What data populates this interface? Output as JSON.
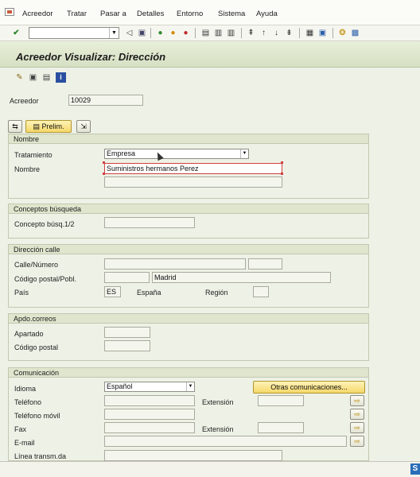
{
  "menu": [
    "Acreedor",
    "Tratar",
    "Pasar a",
    "Detalles",
    "Entorno",
    "Sistema",
    "Ayuda"
  ],
  "title": "Acreedor Visualizar: Dirección",
  "acreedor": {
    "label": "Acreedor",
    "value": "10029"
  },
  "prelim_label": "Prelim.",
  "nombre": {
    "header": "Nombre",
    "tratamiento_label": "Tratamiento",
    "tratamiento_value": "Empresa",
    "nombre_label": "Nombre",
    "nombre_value": "Suministros hermanos Perez"
  },
  "conceptos": {
    "header": "Conceptos búsqueda",
    "label": "Concepto búsq.1/2"
  },
  "direccion": {
    "header": "Dirección calle",
    "calle_label": "Calle/Número",
    "cp_label": "Código postal/Pobl.",
    "poblacion": "Madrid",
    "pais_label": "País",
    "pais_code": "ES",
    "pais_name": "España",
    "region_label": "Región"
  },
  "apdo": {
    "header": "Apdo.correos",
    "apartado_label": "Apartado",
    "cp_label": "Código postal"
  },
  "comunicacion": {
    "header": "Comunicación",
    "idioma_label": "Idioma",
    "idioma_value": "Español",
    "otras_button": "Otras comunicaciones...",
    "telefono_label": "Teléfono",
    "extension_label": "Extensión",
    "movil_label": "Teléfono móvil",
    "fax_label": "Fax",
    "fax_extension_label": "Extensión",
    "email_label": "E-mail",
    "linea_label": "Línea transm.da"
  },
  "colors": {
    "title_band": "#d6e0c3",
    "group_header": "#dfe6cd",
    "button_yellow": "#f5d86a"
  },
  "icons": [
    "check-icon",
    "back-icon",
    "save-icon",
    "green-arrow-icon",
    "exit-icon",
    "cancel-icon",
    "print-icon",
    "find-icon",
    "find-next-icon",
    "first-page-icon",
    "prev-page-icon",
    "next-page-icon",
    "last-page-icon",
    "new-session-icon",
    "shortcut-icon",
    "help-icon",
    "layout-icon",
    "edit-icon",
    "other-vendor-icon",
    "change-icon",
    "info-icon",
    "other-object-icon",
    "prelim-icon"
  ]
}
